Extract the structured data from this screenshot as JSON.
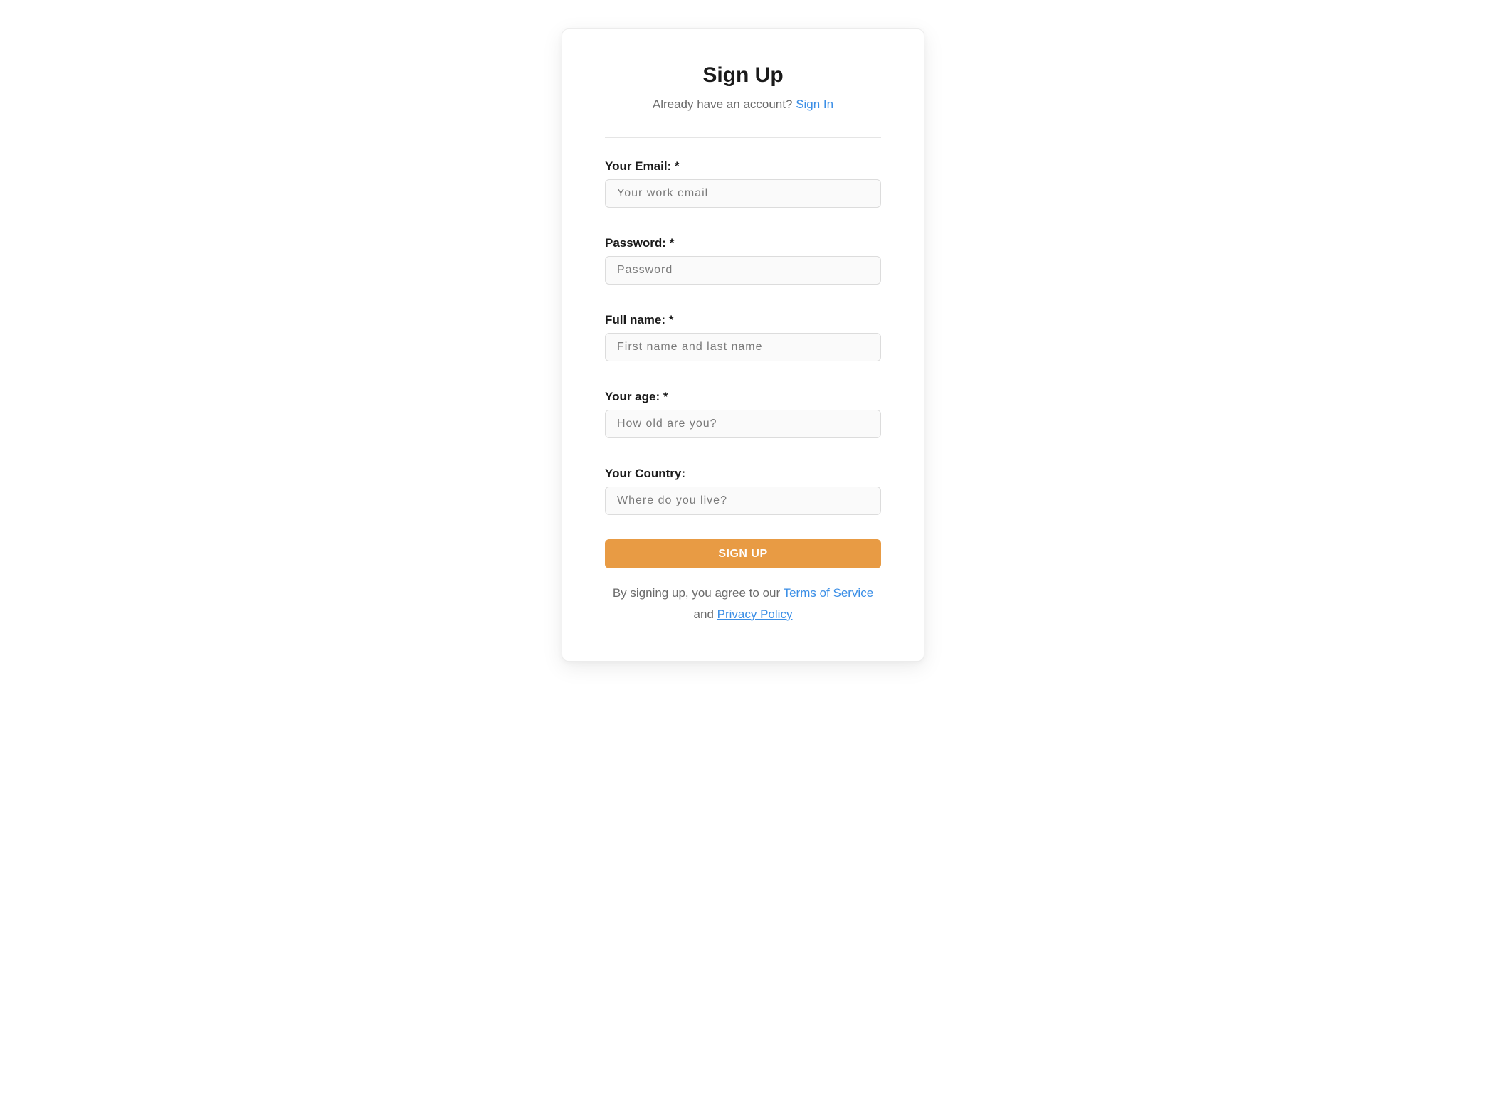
{
  "header": {
    "title": "Sign Up",
    "already_text": "Already have an account?",
    "signin_link": "Sign In"
  },
  "fields": {
    "email": {
      "label": "Your Email: *",
      "placeholder": "Your work email"
    },
    "password": {
      "label": "Password: *",
      "placeholder": "Password"
    },
    "fullname": {
      "label": "Full name: *",
      "placeholder": "First name and last name"
    },
    "age": {
      "label": "Your age: *",
      "placeholder": "How old are you?"
    },
    "country": {
      "label": "Your Country:",
      "placeholder": "Where do you live?"
    }
  },
  "submit": {
    "label": "SIGN UP"
  },
  "terms": {
    "prefix": "By signing up, you agree to our ",
    "tos": "Terms of Service",
    "middle": " and ",
    "privacy": "Privacy Policy"
  }
}
